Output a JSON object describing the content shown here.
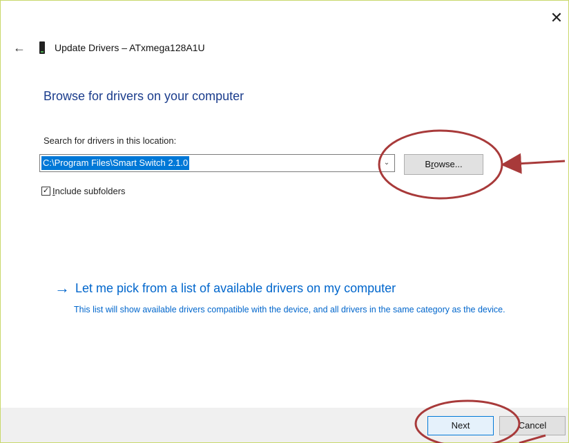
{
  "window": {
    "close_glyph": "✕"
  },
  "header": {
    "back_glyph": "←",
    "title": "Update Drivers – ATxmega128A1U",
    "device_icon": "device-icon"
  },
  "main": {
    "heading": "Browse for drivers on your computer",
    "search_label": "Search for drivers in this location:",
    "path_value": "C:\\Program Files\\Smart Switch 2.1.0",
    "combo_arrow_glyph": "⌄",
    "browse_label": "Browse...",
    "include_subfolders": {
      "label": "Include subfolders",
      "checked": true,
      "check_glyph": "✓"
    },
    "pick_link": {
      "arrow_glyph": "→",
      "text": "Let me pick from a list of available drivers on my computer",
      "description": "This list will show available drivers compatible with the device, and all drivers in the same category as the device."
    }
  },
  "footer": {
    "next_label": "Next",
    "cancel_label": "Cancel"
  },
  "colors": {
    "heading": "#1a3c8c",
    "link": "#0066cc",
    "selection": "#0078d7",
    "annotation": "#a83a3a",
    "window_border": "#c8d86a"
  }
}
